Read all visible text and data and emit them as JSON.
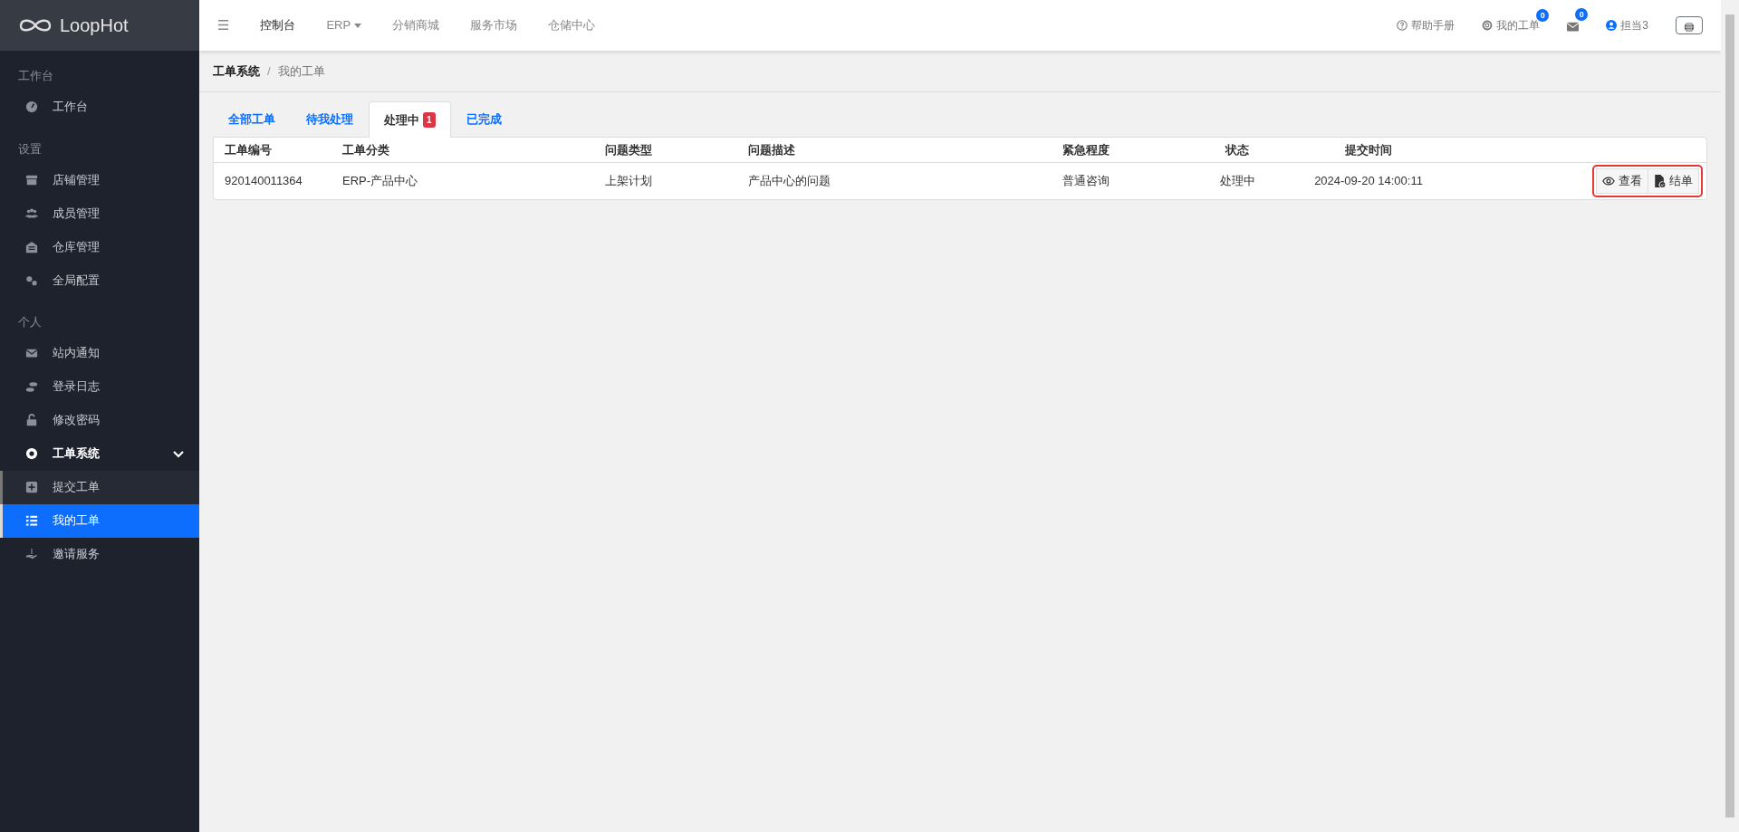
{
  "brand": {
    "name": "LoopHot"
  },
  "sidebar": {
    "sections": [
      {
        "title": "工作台",
        "items": [
          {
            "label": "工作台",
            "selected": false
          }
        ]
      },
      {
        "title": "设置",
        "items": [
          {
            "label": "店铺管理",
            "selected": false
          },
          {
            "label": "成员管理",
            "selected": false
          },
          {
            "label": "仓库管理",
            "selected": false
          },
          {
            "label": "全局配置",
            "selected": false
          }
        ]
      },
      {
        "title": "个人",
        "items": [
          {
            "label": "站内通知",
            "selected": false
          },
          {
            "label": "登录日志",
            "selected": false
          },
          {
            "label": "修改密码",
            "selected": false
          },
          {
            "label": "工单系统",
            "selected": false,
            "expanded": true,
            "children": [
              {
                "label": "提交工单",
                "selected": false
              },
              {
                "label": "我的工单",
                "selected": true
              }
            ]
          },
          {
            "label": "邀请服务",
            "selected": false
          }
        ]
      }
    ]
  },
  "navbar": {
    "toggle": "☰",
    "links": [
      {
        "label": "控制台",
        "selected": true,
        "dropdown": false
      },
      {
        "label": "ERP",
        "selected": false,
        "dropdown": true
      },
      {
        "label": "分销商城",
        "selected": false,
        "dropdown": false
      },
      {
        "label": "服务市场",
        "selected": false,
        "dropdown": false
      },
      {
        "label": "仓储中心",
        "selected": false,
        "dropdown": false
      }
    ],
    "right": [
      {
        "kind": "help",
        "label": "帮助手册"
      },
      {
        "kind": "tickets",
        "label": "我的工单",
        "badge": "0"
      },
      {
        "kind": "mail",
        "badge": "0"
      },
      {
        "kind": "user",
        "label": "担当3"
      },
      {
        "kind": "language"
      }
    ]
  },
  "breadcrumb": {
    "separator": "/",
    "items": [
      "工单系统",
      "我的工单"
    ]
  },
  "tabs": [
    {
      "label": "全部工单",
      "selected": false
    },
    {
      "label": "待我处理",
      "selected": false
    },
    {
      "label": "处理中",
      "selected": true,
      "badge": "1"
    },
    {
      "label": "已完成",
      "selected": false
    }
  ],
  "table": {
    "columns": [
      "工单编号",
      "工单分类",
      "问题类型",
      "问题描述",
      "紧急程度",
      "状态",
      "提交时间"
    ],
    "rows": [
      {
        "cells": [
          "920140011364",
          "ERP-产品中心",
          "上架计划",
          "产品中心的问题",
          "普通咨询",
          "处理中",
          "2024-09-20 14:00:11"
        ],
        "actions": [
          {
            "kind": "view",
            "label": "查看"
          },
          {
            "kind": "close",
            "label": "结单"
          }
        ],
        "highlighted": true
      }
    ]
  }
}
